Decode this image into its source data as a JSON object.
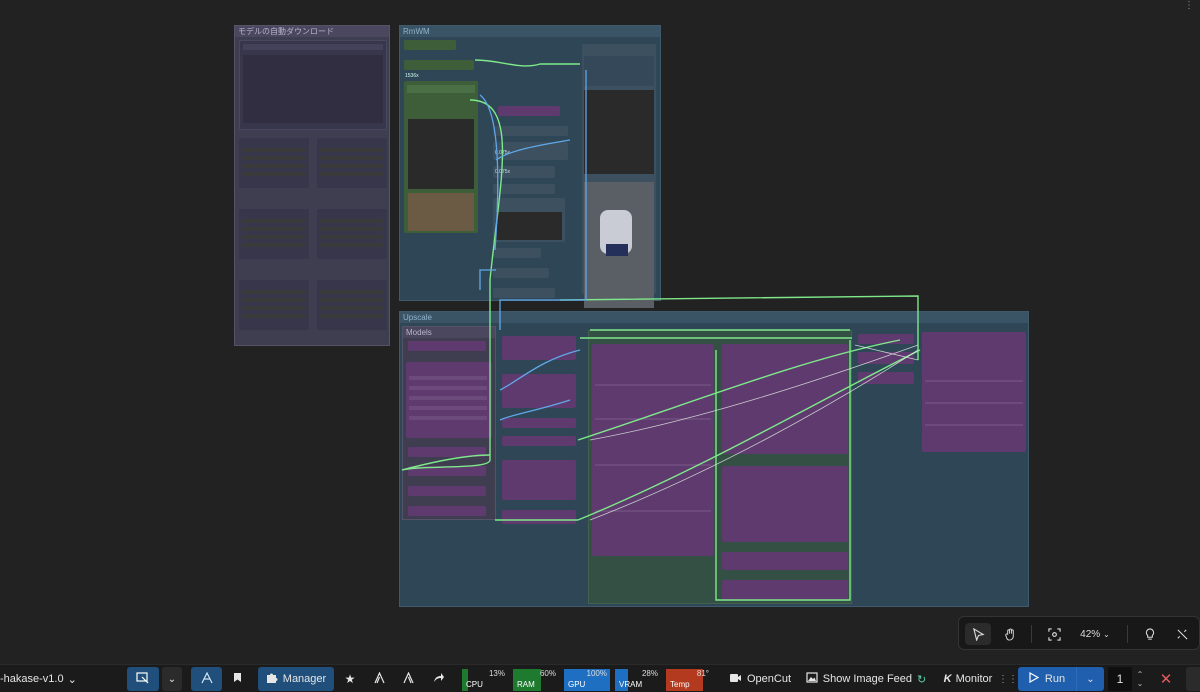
{
  "groups": {
    "download": {
      "title": "モデルの自動ダウンロード"
    },
    "rmwm": {
      "title": "RmWM",
      "node_labels": {
        "size": "1536x",
        "v1": "0.075x",
        "v2": "0.075x"
      }
    },
    "upscale": {
      "title": "Upscale",
      "subgroup_title": "Models"
    }
  },
  "toolbar": {
    "workflow_name": "-hakase-v1.0",
    "manager_label": "Manager",
    "meters": [
      {
        "label": "CPU",
        "value": "13%",
        "color": "#1d7a2e",
        "fraction": 0.13
      },
      {
        "label": "RAM",
        "value": "60%",
        "color": "#1d7a2e",
        "fraction": 0.6
      },
      {
        "label": "GPU",
        "value": "100%",
        "color": "#1e6fc2",
        "fraction": 1.0
      },
      {
        "label": "VRAM",
        "value": "28%",
        "color": "#1e6fc2",
        "fraction": 0.28
      },
      {
        "label": "Temp",
        "value": "81°",
        "color": "#b33a1f",
        "fraction": 0.81
      }
    ],
    "opencut_label": "OpenCut",
    "image_feed_label": "Show Image Feed",
    "monitor_label": "Monitor",
    "run_label": "Run",
    "batch_count": "1",
    "icons": [
      "queue-icon",
      "comfy-logo-icon",
      "bookmark-icon",
      "puzzle-icon",
      "star-icon",
      "share-icon",
      "camera-icon",
      "image-icon",
      "close-icon"
    ]
  },
  "canvas_controls": {
    "zoom": "42%",
    "icons": [
      "pointer-icon",
      "hand-icon",
      "fit-view-icon",
      "lightbulb-icon",
      "link-visibility-icon"
    ]
  },
  "colors": {
    "background": "#222222",
    "group_blue": "#354d5e",
    "group_purple": "#3f3d50",
    "node_purple": "#5e3a6e",
    "node_green": "#3d5e38",
    "wire_green": "#7ee88a",
    "wire_blue": "#5fa8e8"
  }
}
